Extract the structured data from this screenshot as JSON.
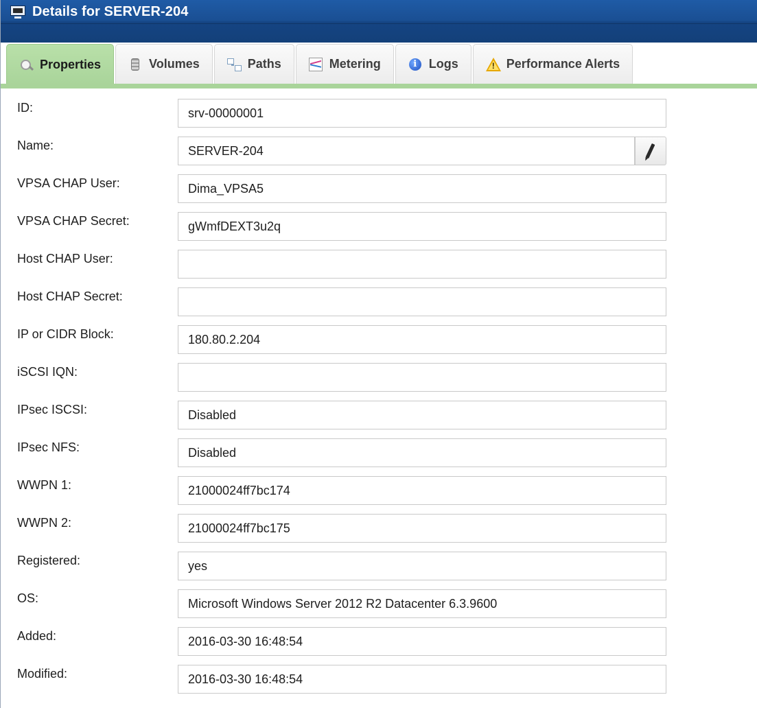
{
  "window": {
    "title": "Details for SERVER-204",
    "icon": "monitor-icon"
  },
  "tabs": [
    {
      "label": "Properties",
      "icon": "magnifier-icon",
      "active": true
    },
    {
      "label": "Volumes",
      "icon": "database-icon",
      "active": false
    },
    {
      "label": "Paths",
      "icon": "paths-icon",
      "active": false
    },
    {
      "label": "Metering",
      "icon": "chart-icon",
      "active": false
    },
    {
      "label": "Logs",
      "icon": "info-icon",
      "active": false
    },
    {
      "label": "Performance Alerts",
      "icon": "warning-icon",
      "active": false
    }
  ],
  "properties": [
    {
      "label": "ID:",
      "value": "srv-00000001"
    },
    {
      "label": "Name:",
      "value": "SERVER-204"
    },
    {
      "label": "VPSA CHAP User:",
      "value": "Dima_VPSA5"
    },
    {
      "label": "VPSA CHAP Secret:",
      "value": "gWmfDEXT3u2q"
    },
    {
      "label": "Host CHAP User:",
      "value": ""
    },
    {
      "label": "Host CHAP Secret:",
      "value": ""
    },
    {
      "label": "IP or CIDR Block:",
      "value": "180.80.2.204"
    },
    {
      "label": "iSCSI IQN:",
      "value": ""
    },
    {
      "label": "IPsec ISCSI:",
      "value": "Disabled"
    },
    {
      "label": "IPsec NFS:",
      "value": "Disabled"
    },
    {
      "label": "WWPN 1:",
      "value": "21000024ff7bc174"
    },
    {
      "label": "WWPN 2:",
      "value": "21000024ff7bc175"
    },
    {
      "label": "Registered:",
      "value": "yes"
    },
    {
      "label": "OS:",
      "value": "Microsoft Windows Server 2012 R2 Datacenter 6.3.9600"
    },
    {
      "label": "Added:",
      "value": "2016-03-30 16:48:54"
    },
    {
      "label": "Modified:",
      "value": "2016-03-30 16:48:54"
    }
  ],
  "colors": {
    "titlebar": "#1a4f93",
    "active_tab": "#a9d49a"
  }
}
